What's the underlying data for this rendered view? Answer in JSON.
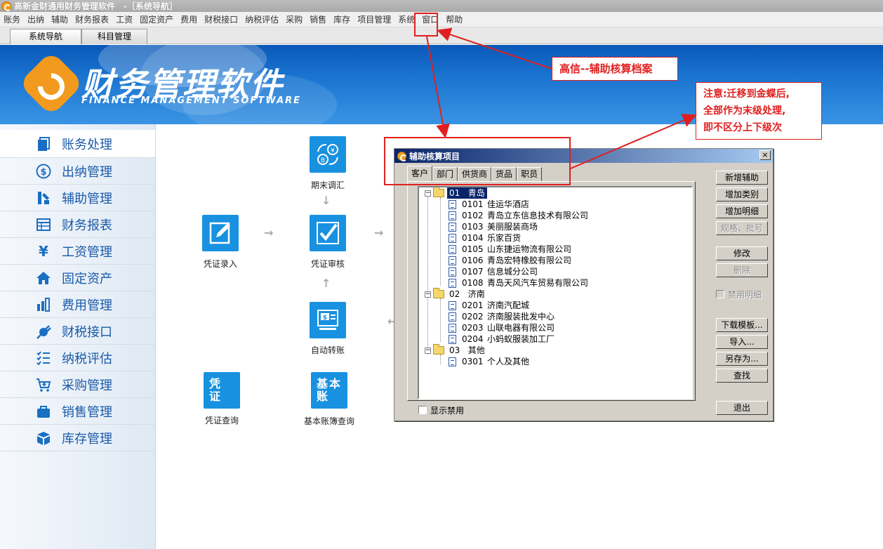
{
  "window": {
    "title": "高新金财通用财务管理软件　-［系统导航］"
  },
  "menu": [
    "账务",
    "出纳",
    "辅助",
    "财务报表",
    "工资",
    "固定资产",
    "费用",
    "财税接口",
    "纳税评估",
    "采购",
    "销售",
    "库存",
    "项目管理",
    "系统",
    "窗口",
    "帮助"
  ],
  "tabs": [
    {
      "label": "系统导航",
      "active": true
    },
    {
      "label": "科目管理",
      "active": false
    }
  ],
  "banner": {
    "title": "财务管理软件",
    "subtitle": "FINANCE MANAGEMENT SOFTWARE"
  },
  "sidebar": {
    "items": [
      {
        "label": "账务处理",
        "icon": "ledger-icon"
      },
      {
        "label": "出纳管理",
        "icon": "dollar-icon"
      },
      {
        "label": "辅助管理",
        "icon": "tools-icon"
      },
      {
        "label": "财务报表",
        "icon": "table-icon"
      },
      {
        "label": "工资管理",
        "icon": "yen-icon"
      },
      {
        "label": "固定资产",
        "icon": "house-icon"
      },
      {
        "label": "费用管理",
        "icon": "bar-chart-icon"
      },
      {
        "label": "财税接口",
        "icon": "plug-icon"
      },
      {
        "label": "纳税评估",
        "icon": "checklist-icon"
      },
      {
        "label": "采购管理",
        "icon": "cart-icon"
      },
      {
        "label": "销售管理",
        "icon": "bag-icon"
      },
      {
        "label": "库存管理",
        "icon": "box-icon"
      }
    ]
  },
  "flow": {
    "period_end": "期末调汇",
    "voucher_entry": "凭证录入",
    "voucher_review": "凭证审核",
    "auto_transfer": "自动转账",
    "voucher_query": "凭证查询",
    "voucher_query_icon": "凭证",
    "ledger_query": "基本账簿查询",
    "ledger_query_icon": "基本账"
  },
  "dialog": {
    "title": "辅助核算项目",
    "close": "×",
    "tabs": [
      "客户",
      "部门",
      "供货商",
      "货品",
      "职员"
    ],
    "active_tab": "客户",
    "tree": [
      {
        "code": "01",
        "name": "青岛",
        "children": [
          {
            "code": "0101",
            "name": "佳运华酒店"
          },
          {
            "code": "0102",
            "name": "青岛立东信息技术有限公司"
          },
          {
            "code": "0103",
            "name": "美丽服装商场"
          },
          {
            "code": "0104",
            "name": "乐家百货"
          },
          {
            "code": "0105",
            "name": "山东捷运物流有限公司"
          },
          {
            "code": "0106",
            "name": "青岛宏特橡胶有限公司"
          },
          {
            "code": "0107",
            "name": "信息城分公司"
          },
          {
            "code": "0108",
            "name": "青岛天风汽车贸易有限公司"
          }
        ]
      },
      {
        "code": "02",
        "name": "济南",
        "children": [
          {
            "code": "0201",
            "name": "济南汽配城"
          },
          {
            "code": "0202",
            "name": "济南服装批发中心"
          },
          {
            "code": "0203",
            "name": "山联电器有限公司"
          },
          {
            "code": "0204",
            "name": "小蚂蚁服装加工厂"
          }
        ]
      },
      {
        "code": "03",
        "name": "其他",
        "children": [
          {
            "code": "0301",
            "name": "个人及其他"
          }
        ]
      }
    ],
    "buttons": {
      "add_aux": "新增辅助",
      "add_category": "增加类别",
      "add_detail": "增加明细",
      "spec_batch": "规格、批号",
      "modify": "修改",
      "delete": "删除",
      "disable_detail": "禁用明细",
      "download_template": "下载模板...",
      "import": "导入...",
      "save_as": "另存为...",
      "find": "查找",
      "exit": "退出"
    },
    "show_disabled": "显示禁用"
  },
  "annotations": {
    "callout1": "高信--辅助核算档案",
    "callout2_lines": [
      "注意:迁移到金蝶后,",
      "全部作为末级处理,",
      "即不区分上下级次"
    ]
  },
  "colors": {
    "accent": "#1891e0",
    "annotation": "#e02020",
    "banner": "#1a74d0",
    "logo": "#f29a1d"
  }
}
